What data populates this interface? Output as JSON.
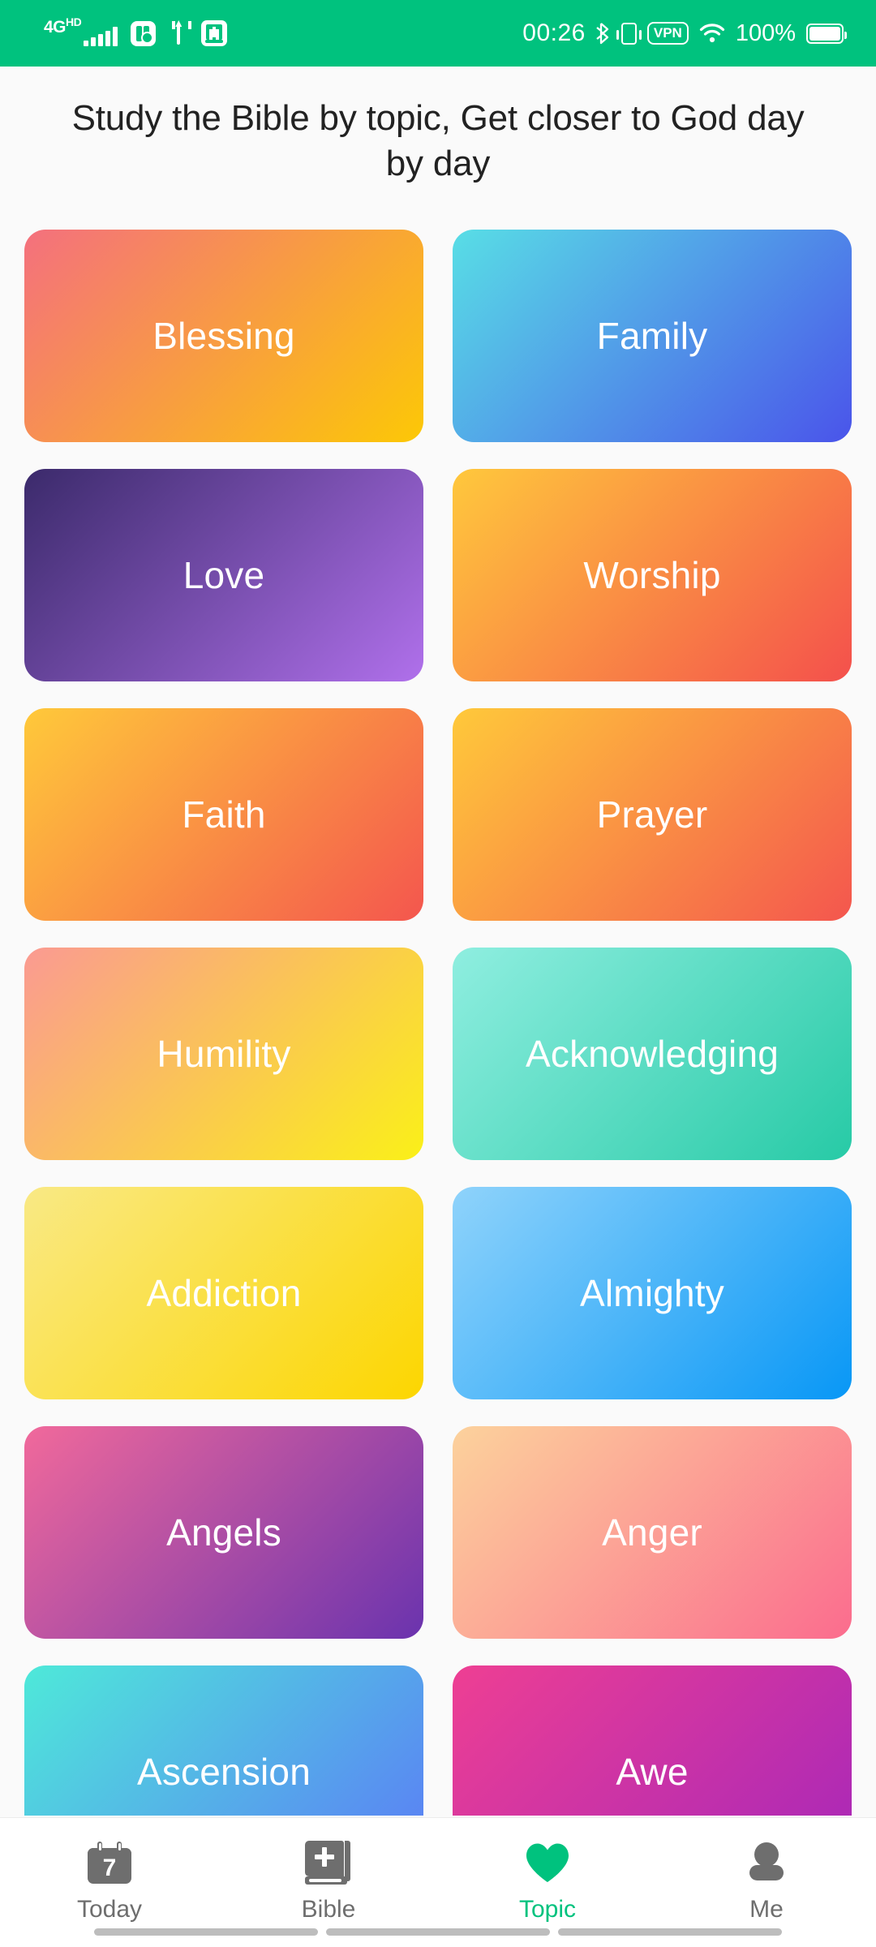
{
  "theme": {
    "accent": "#00C27E",
    "statusbar_bg": "#00C27E",
    "page_bg": "#FAFAFA",
    "nav_bg": "#FFFFFF",
    "nav_inactive": "#6E6E6E",
    "title_color": "#222222",
    "card_label_color": "#FFFFFF"
  },
  "statusbar": {
    "network_label": "4G",
    "network_sup": "HD",
    "signal_bars": 5,
    "icons_left": [
      "signal-bars-icon",
      "app-settings-badge-icon",
      "usb-icon",
      "bible-app-icon"
    ],
    "time": "00:26",
    "bluetooth_icon": "bluetooth-icon",
    "vibrate_icon": "vibrate-icon",
    "vpn_label": "VPN",
    "wifi_icon": "wifi-icon",
    "battery_percent": "100%",
    "battery_icon": "battery-full-icon"
  },
  "header": {
    "title": "Study the Bible by topic, Get closer to God day by day"
  },
  "topics": [
    {
      "label": "Blessing",
      "from": "#F4707E",
      "to": "#FCC806"
    },
    {
      "label": "Family",
      "from": "#58DEE6",
      "to": "#4A54EA"
    },
    {
      "label": "Love",
      "from": "#3B2A6B",
      "to": "#B070EB"
    },
    {
      "label": "Worship",
      "from": "#FFC83C",
      "to": "#F4504C"
    },
    {
      "label": "Faith",
      "from": "#FFC93A",
      "to": "#F4564E"
    },
    {
      "label": "Prayer",
      "from": "#FFC93A",
      "to": "#F4564E"
    },
    {
      "label": "Humility",
      "from": "#FA9A92",
      "to": "#FAF018"
    },
    {
      "label": "Acknowledging",
      "from": "#8FEEE0",
      "to": "#27CAA6"
    },
    {
      "label": "Addiction",
      "from": "#F9E985",
      "to": "#FCD600"
    },
    {
      "label": "Almighty",
      "from": "#8FD3FB",
      "to": "#0897F6"
    },
    {
      "label": "Angels",
      "from": "#F1699B",
      "to": "#6A33AE"
    },
    {
      "label": "Anger",
      "from": "#FCD29C",
      "to": "#FB6C8E"
    },
    {
      "label": "Ascension",
      "from": "#4EE9D9",
      "to": "#5B7BF6"
    },
    {
      "label": "Awe",
      "from": "#EE3F93",
      "to": "#A727B9"
    }
  ],
  "bottom_nav": {
    "active": "Topic",
    "items": [
      {
        "label": "Today",
        "icon": "calendar-icon",
        "badge": "7"
      },
      {
        "label": "Bible",
        "icon": "book-plus-icon"
      },
      {
        "label": "Topic",
        "icon": "heart-icon"
      },
      {
        "label": "Me",
        "icon": "person-icon"
      }
    ]
  }
}
